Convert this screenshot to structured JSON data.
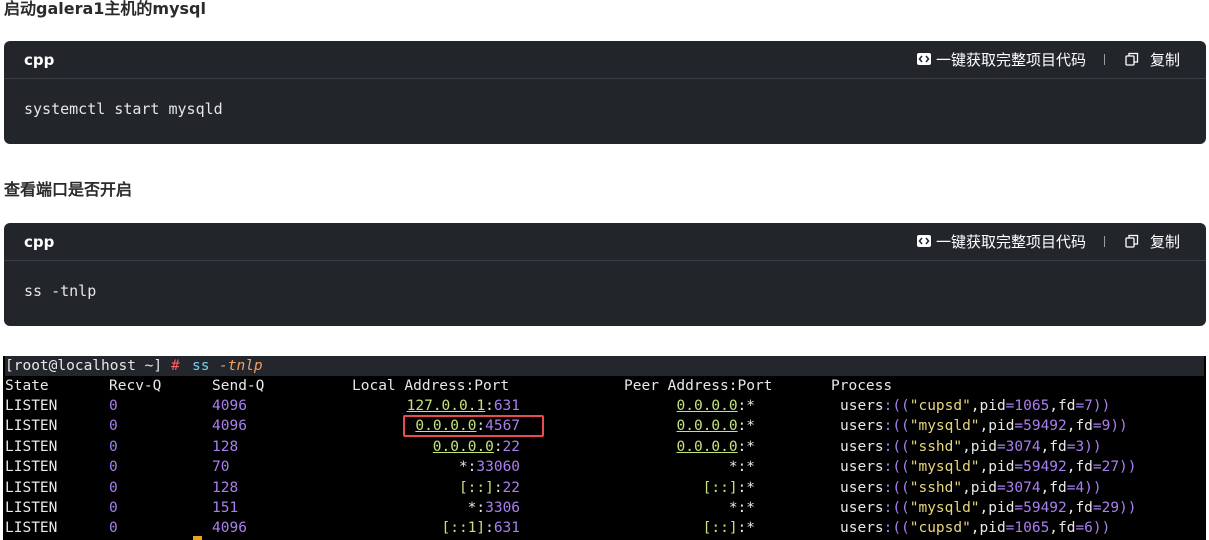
{
  "section1": {
    "heading": "启动galera1主机的mysql",
    "lang": "cpp",
    "get_code_label": "一键获取完整项目代码",
    "copy_label": "复制",
    "code": "systemctl start mysqld"
  },
  "section2": {
    "heading": "查看端口是否开启",
    "lang": "cpp",
    "get_code_label": "一键获取完整项目代码",
    "copy_label": "复制",
    "code": "ss -tnlp"
  },
  "terminal": {
    "prompt": "[root@localhost ~]",
    "prompt_hash": "#",
    "cmd": "ss",
    "cmd_flag": "-tnlp",
    "headers": {
      "state": "State",
      "recvq": "Recv-Q",
      "sendq": "Send-Q",
      "local": "Local Address:Port",
      "peer": "Peer Address:Port",
      "process": "Process"
    },
    "rows": [
      {
        "state": "LISTEN",
        "recvq": "0",
        "sendq": "4096",
        "local_addr": "127.0.0.1",
        "local_port": "631",
        "peer_addr": "0.0.0.0",
        "peer_port": "*",
        "proc_name": "cupsd",
        "pid": "1065",
        "fd": "7"
      },
      {
        "state": "LISTEN",
        "recvq": "0",
        "sendq": "4096",
        "local_addr": "0.0.0.0",
        "local_port": "4567",
        "peer_addr": "0.0.0.0",
        "peer_port": "*",
        "proc_name": "mysqld",
        "pid": "59492",
        "fd": "9"
      },
      {
        "state": "LISTEN",
        "recvq": "0",
        "sendq": "128",
        "local_addr": "0.0.0.0",
        "local_port": "22",
        "peer_addr": "0.0.0.0",
        "peer_port": "*",
        "proc_name": "sshd",
        "pid": "3074",
        "fd": "3"
      },
      {
        "state": "LISTEN",
        "recvq": "0",
        "sendq": "70",
        "local_addr": "*",
        "local_port": "33060",
        "peer_addr": "*",
        "peer_port": "*",
        "proc_name": "mysqld",
        "pid": "59492",
        "fd": "27"
      },
      {
        "state": "LISTEN",
        "recvq": "0",
        "sendq": "128",
        "local_addr": "[::]",
        "local_port": "22",
        "peer_addr": "[::]",
        "peer_port": "*",
        "proc_name": "sshd",
        "pid": "3074",
        "fd": "4"
      },
      {
        "state": "LISTEN",
        "recvq": "0",
        "sendq": "151",
        "local_addr": "*",
        "local_port": "3306",
        "peer_addr": "*",
        "peer_port": "*",
        "proc_name": "mysqld",
        "pid": "59492",
        "fd": "29"
      },
      {
        "state": "LISTEN",
        "recvq": "0",
        "sendq": "4096",
        "local_addr": "[::1]",
        "local_port": "631",
        "peer_addr": "[::]",
        "peer_port": "*",
        "proc_name": "cupsd",
        "pid": "1065",
        "fd": "6"
      }
    ]
  }
}
